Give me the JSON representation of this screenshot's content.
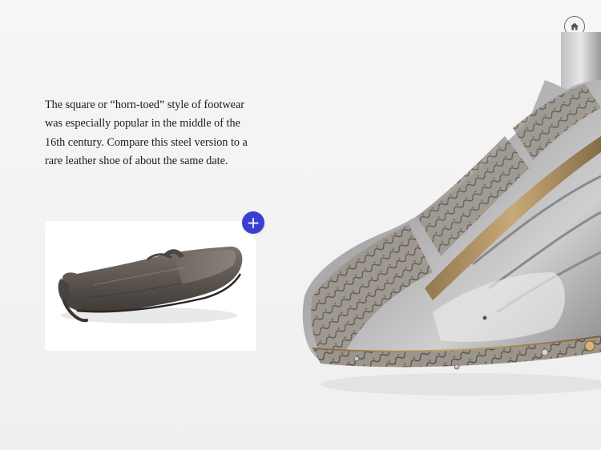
{
  "nav": {
    "home_icon": "home-icon"
  },
  "caption": {
    "text": "The square or “horn-toed” style of footwear was especially popular in the middle of the 16th century. Compare this steel version to a rare leather shoe of about the same date."
  },
  "related_image": {
    "expand_icon": "plus-icon",
    "expand_label": "+"
  },
  "colors": {
    "accent": "#3a3fd1",
    "background": "#f3f3f3",
    "text": "#1b1b1b"
  }
}
